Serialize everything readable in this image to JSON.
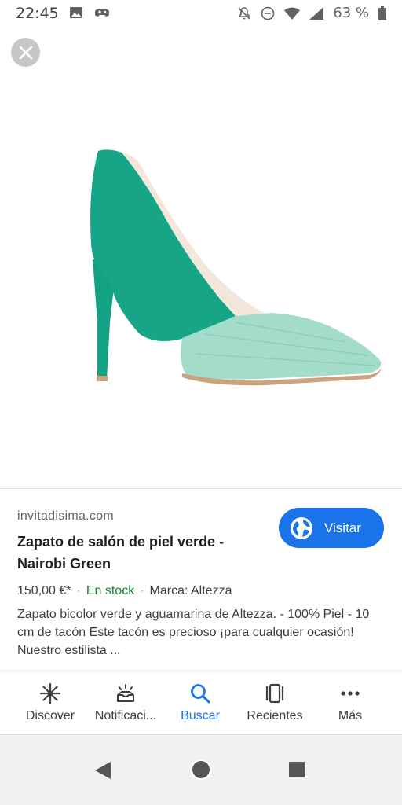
{
  "status_bar": {
    "time": "22:45",
    "battery_text": "63 %",
    "icons_left": [
      "image-icon",
      "game-controller-icon"
    ],
    "icons_right": [
      "notifications-off-icon",
      "do-not-disturb-icon",
      "wifi-icon",
      "signal-icon",
      "battery-icon"
    ]
  },
  "viewer": {
    "close_icon": "close-icon",
    "image_subject": "green-pump-shoe",
    "colors": {
      "suede": "#16a587",
      "leather": "#a3dccb",
      "sole": "#c9a27e"
    }
  },
  "result": {
    "domain": "invitadisima.com",
    "title": "Zapato de salón de piel verde - Nairobi Green",
    "visit_label": "Visitar",
    "price": "150,00 €*",
    "stock": "En stock",
    "brand": "Marca: Altezza",
    "description": "Zapato bicolor verde y aguamarina de Altezza. - 100% Piel - 10 cm de tacón Este tacón es precioso ¡para cualquier ocasión! Nuestro estilista ..."
  },
  "bottom_nav": {
    "items": [
      {
        "label": "Discover",
        "icon": "asterisk-icon"
      },
      {
        "label": "Notificaci...",
        "icon": "notifications-icon"
      },
      {
        "label": "Buscar",
        "icon": "search-icon"
      },
      {
        "label": "Recientes",
        "icon": "recents-icon"
      },
      {
        "label": "Más",
        "icon": "more-horizontal-icon"
      }
    ],
    "active": "Buscar"
  },
  "system_nav": {
    "buttons": [
      "back-icon",
      "home-icon",
      "overview-icon"
    ]
  },
  "colors": {
    "accent": "#1a73e8",
    "stock_green": "#188038"
  }
}
